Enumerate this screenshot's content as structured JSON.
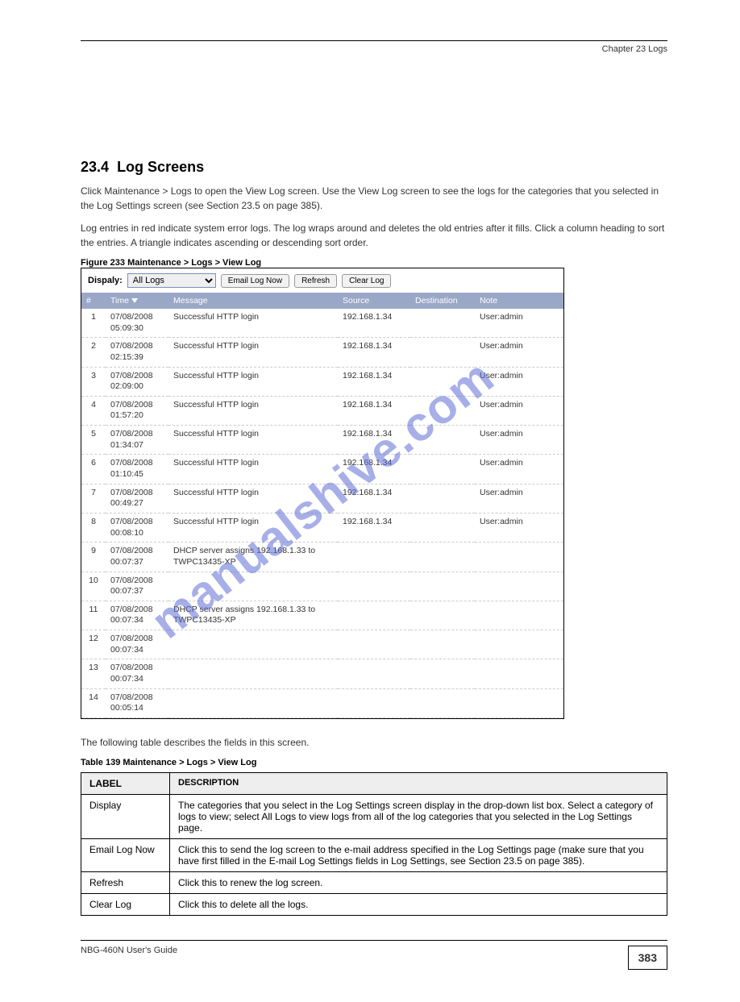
{
  "chapter_line": "Chapter 23 Logs",
  "section": {
    "num": "23.4",
    "title": "Log Screens",
    "intro": "Click Maintenance > Logs to open the View Log screen. Use the View Log screen to see the logs for the categories that you selected in the Log Settings screen (see Section 23.5 on page 385).",
    "intro2": "Log entries in red indicate system error logs. The log wraps around and deletes the old entries after it fills. Click a column heading to sort the entries. A triangle indicates ascending or descending sort order."
  },
  "fig_caption": "Figure 233   Maintenance > Logs > View Log",
  "screenshot": {
    "display_label": "Dispaly:",
    "display_value": "All Logs",
    "buttons": {
      "email": "Email Log Now",
      "refresh": "Refresh",
      "clear": "Clear Log"
    },
    "columns": {
      "num": "#",
      "time": "Time",
      "message": "Message",
      "source": "Source",
      "destination": "Destination",
      "note": "Note"
    },
    "rows": [
      {
        "n": "1",
        "time": "07/08/2008 05:09:30",
        "msg": "Successful HTTP login",
        "src": "192.168.1.34",
        "dst": "",
        "note": "User:admin"
      },
      {
        "n": "2",
        "time": "07/08/2008 02:15:39",
        "msg": "Successful HTTP login",
        "src": "192.168.1.34",
        "dst": "",
        "note": "User:admin"
      },
      {
        "n": "3",
        "time": "07/08/2008 02:09:00",
        "msg": "Successful HTTP login",
        "src": "192.168.1.34",
        "dst": "",
        "note": "User:admin"
      },
      {
        "n": "4",
        "time": "07/08/2008 01:57:20",
        "msg": "Successful HTTP login",
        "src": "192.168.1.34",
        "dst": "",
        "note": "User:admin"
      },
      {
        "n": "5",
        "time": "07/08/2008 01:34:07",
        "msg": "Successful HTTP login",
        "src": "192.168.1.34",
        "dst": "",
        "note": "User:admin"
      },
      {
        "n": "6",
        "time": "07/08/2008 01:10:45",
        "msg": "Successful HTTP login",
        "src": "192.168.1.34",
        "dst": "",
        "note": "User:admin"
      },
      {
        "n": "7",
        "time": "07/08/2008 00:49:27",
        "msg": "Successful HTTP login",
        "src": "192.168.1.34",
        "dst": "",
        "note": "User:admin"
      },
      {
        "n": "8",
        "time": "07/08/2008 00:08:10",
        "msg": "Successful HTTP login",
        "src": "192.168.1.34",
        "dst": "",
        "note": "User:admin"
      },
      {
        "n": "9",
        "time": "07/08/2008 00:07:37",
        "msg": "DHCP server assigns 192.168.1.33 to TWPC13435-XP",
        "src": "",
        "dst": "",
        "note": ""
      },
      {
        "n": "10",
        "time": "07/08/2008 00:07:37",
        "msg": "",
        "src": "",
        "dst": "",
        "note": ""
      },
      {
        "n": "11",
        "time": "07/08/2008 00:07:34",
        "msg": "DHCP server assigns 192.168.1.33 to TWPC13435-XP",
        "src": "",
        "dst": "",
        "note": ""
      },
      {
        "n": "12",
        "time": "07/08/2008 00:07:34",
        "msg": "",
        "src": "",
        "dst": "",
        "note": ""
      },
      {
        "n": "13",
        "time": "07/08/2008 00:07:34",
        "msg": "",
        "src": "",
        "dst": "",
        "note": ""
      },
      {
        "n": "14",
        "time": "07/08/2008 00:05:14",
        "msg": "",
        "src": "",
        "dst": "",
        "note": ""
      }
    ]
  },
  "watermark": "manualshive.com",
  "desc_intro": "The following table describes the fields in this screen.",
  "table_caption": "Table 139   Maintenance > Logs > View Log",
  "desc_table": {
    "head_label": "LABEL",
    "head_desc": "DESCRIPTION",
    "rows": [
      {
        "label": "Display",
        "desc": "The categories that you select in the Log Settings screen display in the drop-down list box. Select a category of logs to view; select All Logs to view logs from all of the log categories that you selected in the Log Settings page."
      },
      {
        "label": "Email Log Now",
        "desc": "Click this to send the log screen to the e-mail address specified in the Log Settings page (make sure that you have first filled in the E-mail Log Settings fields in Log Settings, see Section 23.5 on page 385)."
      },
      {
        "label": "Refresh",
        "desc": "Click this to renew the log screen."
      },
      {
        "label": "Clear Log",
        "desc": "Click this to delete all the logs."
      }
    ]
  },
  "footer_text": "NBG-460N User's Guide",
  "page_number": "383"
}
